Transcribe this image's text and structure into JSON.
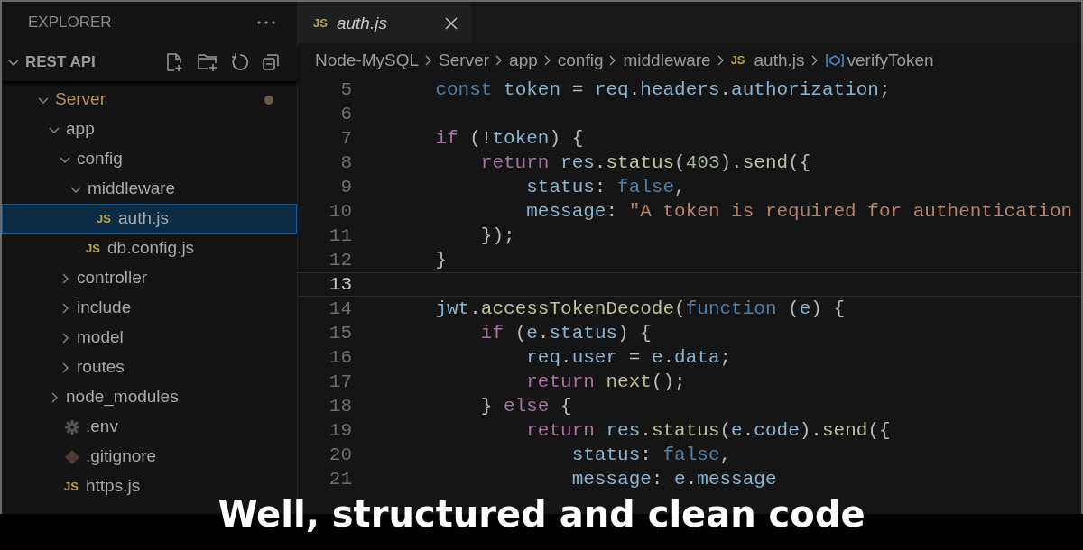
{
  "explorer": {
    "title": "EXPLORER",
    "section": {
      "label": "REST API",
      "expanded": true
    },
    "tree": [
      {
        "label": "Server",
        "kind": "folder",
        "expanded": true,
        "modified": true,
        "selected": false,
        "children": [
          {
            "label": "app",
            "kind": "folder",
            "expanded": true,
            "modified": false,
            "selected": false,
            "children": [
              {
                "label": "config",
                "kind": "folder",
                "expanded": true,
                "modified": false,
                "selected": false,
                "children": [
                  {
                    "label": "middleware",
                    "kind": "folder",
                    "expanded": true,
                    "modified": false,
                    "selected": false,
                    "children": [
                      {
                        "label": "auth.js",
                        "kind": "js",
                        "badge": "JS",
                        "modified": false,
                        "selected": true
                      }
                    ]
                  },
                  {
                    "label": "db.config.js",
                    "kind": "js",
                    "badge": "JS",
                    "modified": false,
                    "selected": false
                  }
                ]
              },
              {
                "label": "controller",
                "kind": "folder",
                "expanded": false,
                "modified": false,
                "selected": false
              },
              {
                "label": "include",
                "kind": "folder",
                "expanded": false,
                "modified": false,
                "selected": false
              },
              {
                "label": "model",
                "kind": "folder",
                "expanded": false,
                "modified": false,
                "selected": false
              },
              {
                "label": "routes",
                "kind": "folder",
                "expanded": false,
                "modified": false,
                "selected": false
              }
            ]
          },
          {
            "label": "node_modules",
            "kind": "folder",
            "expanded": false,
            "modified": false,
            "selected": false
          },
          {
            "label": ".env",
            "kind": "settings",
            "modified": false,
            "selected": false
          },
          {
            "label": ".gitignore",
            "kind": "git",
            "modified": false,
            "selected": false
          },
          {
            "label": "https.js",
            "kind": "js",
            "badge": "JS",
            "modified": false,
            "selected": false
          }
        ]
      }
    ]
  },
  "tab": {
    "label": "auth.js",
    "badge": "JS",
    "preview": true,
    "selected": true
  },
  "breadcrumb": [
    {
      "label": "Node-MySQL",
      "kind": "folder"
    },
    {
      "label": "Server",
      "kind": "folder"
    },
    {
      "label": "app",
      "kind": "folder"
    },
    {
      "label": "config",
      "kind": "folder"
    },
    {
      "label": "middleware",
      "kind": "folder"
    },
    {
      "label": "auth.js",
      "kind": "js",
      "badge": "JS"
    },
    {
      "label": "verifyToken",
      "kind": "symbol"
    }
  ],
  "code": [
    {
      "number": "5",
      "current": false,
      "tokens": [
        {
          "text": "    const",
          "kind": "keyword"
        },
        {
          "text": " token",
          "kind": "variable"
        },
        {
          "text": " = ",
          "kind": "plain"
        },
        {
          "text": "req",
          "kind": "variable"
        },
        {
          "text": ".",
          "kind": "plain"
        },
        {
          "text": "headers",
          "kind": "variable"
        },
        {
          "text": ".",
          "kind": "plain"
        },
        {
          "text": "authorization",
          "kind": "variable"
        },
        {
          "text": ";",
          "kind": "plain"
        }
      ]
    },
    {
      "number": "6",
      "current": false
    },
    {
      "number": "7",
      "current": false,
      "tokens": [
        {
          "text": "    if",
          "kind": "control"
        },
        {
          "text": " (!",
          "kind": "plain"
        },
        {
          "text": "token",
          "kind": "variable"
        },
        {
          "text": ") {",
          "kind": "plain"
        }
      ]
    },
    {
      "number": "8",
      "current": false,
      "tokens": [
        {
          "text": "        return",
          "kind": "control"
        },
        {
          "text": " res",
          "kind": "variable"
        },
        {
          "text": ".",
          "kind": "plain"
        },
        {
          "text": "status",
          "kind": "function"
        },
        {
          "text": "(",
          "kind": "plain"
        },
        {
          "text": "403",
          "kind": "number"
        },
        {
          "text": ").",
          "kind": "plain"
        },
        {
          "text": "send",
          "kind": "function"
        },
        {
          "text": "({",
          "kind": "plain"
        }
      ]
    },
    {
      "number": "9",
      "current": false,
      "tokens": [
        {
          "text": "            status",
          "kind": "variable"
        },
        {
          "text": ": ",
          "kind": "plain"
        },
        {
          "text": "false",
          "kind": "keyword"
        },
        {
          "text": ",",
          "kind": "plain"
        }
      ]
    },
    {
      "number": "10",
      "current": false,
      "tokens": [
        {
          "text": "            message",
          "kind": "variable"
        },
        {
          "text": ": ",
          "kind": "plain"
        },
        {
          "text": "\"A token is required for authentication",
          "kind": "string"
        }
      ]
    },
    {
      "number": "11",
      "current": false,
      "tokens": [
        {
          "text": "        });",
          "kind": "plain"
        }
      ]
    },
    {
      "number": "12",
      "current": false,
      "tokens": [
        {
          "text": "    }",
          "kind": "plain"
        }
      ]
    },
    {
      "number": "13",
      "current": true
    },
    {
      "number": "14",
      "current": false,
      "tokens": [
        {
          "text": "    jwt",
          "kind": "variable"
        },
        {
          "text": ".",
          "kind": "plain"
        },
        {
          "text": "accessTokenDecode",
          "kind": "function"
        },
        {
          "text": "(",
          "kind": "plain"
        },
        {
          "text": "function",
          "kind": "keyword"
        },
        {
          "text": " (",
          "kind": "plain"
        },
        {
          "text": "e",
          "kind": "variable"
        },
        {
          "text": ") {",
          "kind": "plain"
        }
      ]
    },
    {
      "number": "15",
      "current": false,
      "tokens": [
        {
          "text": "        if",
          "kind": "control"
        },
        {
          "text": " (",
          "kind": "plain"
        },
        {
          "text": "e",
          "kind": "variable"
        },
        {
          "text": ".",
          "kind": "plain"
        },
        {
          "text": "status",
          "kind": "variable"
        },
        {
          "text": ") {",
          "kind": "plain"
        }
      ]
    },
    {
      "number": "16",
      "current": false,
      "tokens": [
        {
          "text": "            req",
          "kind": "variable"
        },
        {
          "text": ".",
          "kind": "plain"
        },
        {
          "text": "user",
          "kind": "variable"
        },
        {
          "text": " = ",
          "kind": "plain"
        },
        {
          "text": "e",
          "kind": "variable"
        },
        {
          "text": ".",
          "kind": "plain"
        },
        {
          "text": "data",
          "kind": "variable"
        },
        {
          "text": ";",
          "kind": "plain"
        }
      ]
    },
    {
      "number": "17",
      "current": false,
      "tokens": [
        {
          "text": "            return",
          "kind": "control"
        },
        {
          "text": " next",
          "kind": "function"
        },
        {
          "text": "();",
          "kind": "plain"
        }
      ]
    },
    {
      "number": "18",
      "current": false,
      "tokens": [
        {
          "text": "        } ",
          "kind": "plain"
        },
        {
          "text": "else",
          "kind": "control"
        },
        {
          "text": " {",
          "kind": "plain"
        }
      ]
    },
    {
      "number": "19",
      "current": false,
      "tokens": [
        {
          "text": "            return",
          "kind": "control"
        },
        {
          "text": " res",
          "kind": "variable"
        },
        {
          "text": ".",
          "kind": "plain"
        },
        {
          "text": "status",
          "kind": "function"
        },
        {
          "text": "(",
          "kind": "plain"
        },
        {
          "text": "e",
          "kind": "variable"
        },
        {
          "text": ".",
          "kind": "plain"
        },
        {
          "text": "code",
          "kind": "variable"
        },
        {
          "text": ").",
          "kind": "plain"
        },
        {
          "text": "send",
          "kind": "function"
        },
        {
          "text": "({",
          "kind": "plain"
        }
      ]
    },
    {
      "number": "20",
      "current": false,
      "tokens": [
        {
          "text": "                status",
          "kind": "variable"
        },
        {
          "text": ": ",
          "kind": "plain"
        },
        {
          "text": "false",
          "kind": "keyword"
        },
        {
          "text": ",",
          "kind": "plain"
        }
      ]
    },
    {
      "number": "21",
      "current": false,
      "tokens": [
        {
          "text": "                message",
          "kind": "variable"
        },
        {
          "text": ": ",
          "kind": "plain"
        },
        {
          "text": "e",
          "kind": "variable"
        },
        {
          "text": ".",
          "kind": "plain"
        },
        {
          "text": "message",
          "kind": "variable"
        }
      ]
    }
  ],
  "caption": "Well, structured and clean code"
}
